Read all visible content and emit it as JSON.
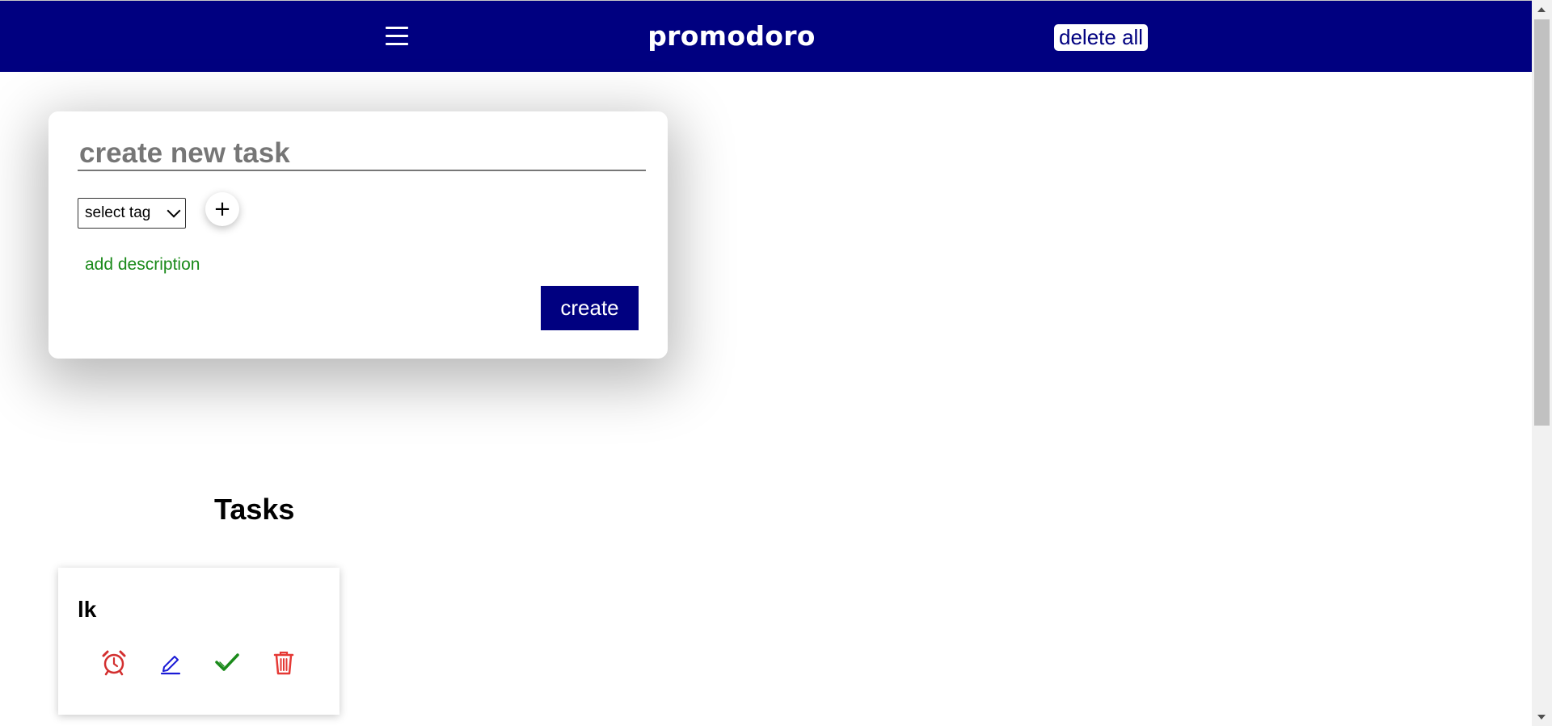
{
  "header": {
    "title": "promodoro",
    "delete_all_label": "delete all",
    "menu_icon": "hamburger-menu-icon",
    "background_color": "#000080"
  },
  "new_task": {
    "input_placeholder": "create new task",
    "input_value": "",
    "tag_select_value": "select tag",
    "add_tag_label": "+",
    "add_description_label": "add description",
    "create_label": "create"
  },
  "tasks_section": {
    "heading": "Tasks",
    "items": [
      {
        "name": "lk",
        "actions": [
          {
            "icon": "alarm-clock-icon",
            "color": "#d32f2f"
          },
          {
            "icon": "pencil-edit-icon",
            "color": "#1a1ad6"
          },
          {
            "icon": "checkmark-icon",
            "color": "#1a8a1a"
          },
          {
            "icon": "trash-icon",
            "color": "#e53935"
          }
        ]
      }
    ]
  },
  "colors": {
    "accent": "#000080",
    "description_link": "#1a8a1a"
  }
}
